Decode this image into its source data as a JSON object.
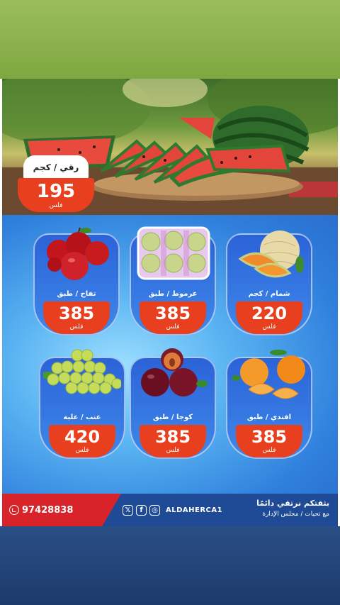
{
  "hero": {
    "unit": "رقي / كجم",
    "price": "195",
    "currency": "فلس"
  },
  "products": [
    {
      "label": "تفاح / طبق",
      "price": "385",
      "currency": "فلس",
      "image": "red-apples"
    },
    {
      "label": "عرموط / طبق",
      "price": "385",
      "currency": "فلس",
      "image": "pears-tray"
    },
    {
      "label": "شمام / كجم",
      "price": "220",
      "currency": "فلس",
      "image": "cantaloupe"
    },
    {
      "label": "عنب / علبة",
      "price": "420",
      "currency": "فلس",
      "image": "green-grapes"
    },
    {
      "label": "كوجا / طبق",
      "price": "385",
      "currency": "فلس",
      "image": "plums"
    },
    {
      "label": "افندي / طبق",
      "price": "385",
      "currency": "فلس",
      "image": "mandarins"
    }
  ],
  "footer": {
    "phone": "97428838",
    "handle": "ALDAHERCA1",
    "slogan_line1": "بثقتكم نرتقي دائمًا",
    "slogan_line2": "مع تحيات / مجلس الإدارة",
    "social_icons": [
      "x-icon",
      "facebook-icon",
      "instagram-icon"
    ]
  },
  "colors": {
    "price_badge": "#e8401f",
    "footer_red": "#d9232a",
    "footer_blue": "#1f4a96",
    "top_band": "#8db34c",
    "bottom_band": "#234579"
  }
}
